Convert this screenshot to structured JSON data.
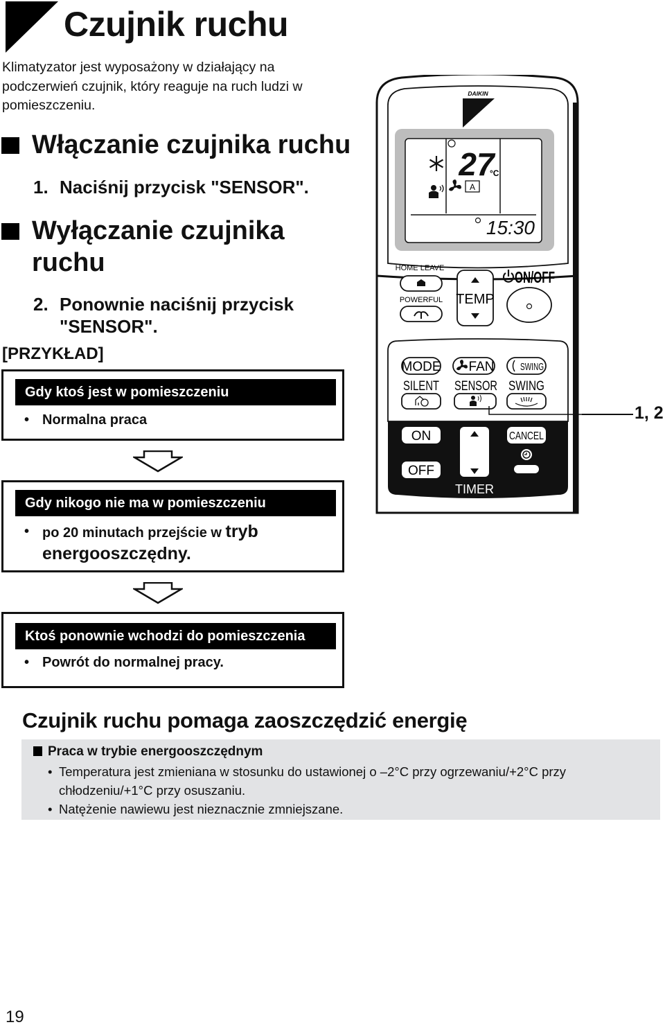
{
  "header": {
    "title": "Czujnik ruchu",
    "intro": "Klimatyzator jest wyposażony w działający na podczerwień czujnik, który reaguje na ruch ludzi w pomieszczeniu."
  },
  "sections": [
    {
      "heading_line1": "Włączanie czujnika ruchu",
      "step_num": "1.",
      "step_text": "Naciśnij przycisk \"SENSOR\"."
    },
    {
      "heading_line1": "Wyłączanie czujnika",
      "heading_line2": "ruchu",
      "step_num": "2.",
      "step_text_line1": "Ponownie naciśnij przycisk",
      "step_text_line2": "\"SENSOR\"."
    }
  ],
  "example": {
    "label": "[PRZYKŁAD]",
    "boxes": [
      {
        "title": "Gdy ktoś jest w pomieszczeniu",
        "bullet": "•",
        "item": "Normalna praca"
      },
      {
        "title": "Gdy nikogo nie ma w pomieszczeniu",
        "bullet": "•",
        "item_part1": "po 20 minutach przejście w",
        "item_part2": "tryb",
        "item_line2": "energooszczędny."
      },
      {
        "title": "Ktoś ponownie wchodzi do pomieszczenia",
        "bullet": "•",
        "item": "Powrót do normalnej pracy."
      }
    ]
  },
  "remote": {
    "brand": "DAIKIN",
    "display": {
      "temperature": "27",
      "unit": "°C",
      "clock": "15:30",
      "mode_icon": "snowflake-cool-icon",
      "sensor_icon": "person-sensor-icon",
      "fan_icon": "fan-icon",
      "fan_mode": "A"
    },
    "buttons": {
      "home_leave": "HOME LEAVE",
      "powerful": "POWERFUL",
      "temp": "TEMP",
      "on_off": "ON/OFF",
      "mode": "MODE",
      "fan": "FAN",
      "swing_top": "SWING",
      "silent": "SILENT",
      "sensor": "SENSOR",
      "swing": "SWING",
      "timer_on": "ON",
      "timer_off": "OFF",
      "cancel": "CANCEL",
      "timer": "TIMER"
    },
    "callout": "1, 2"
  },
  "energy": {
    "title": "Czujnik ruchu pomaga zaoszczędzić energię",
    "subheading": "Praca w trybie energooszczędnym",
    "items": [
      "Temperatura jest zmieniana w stosunku do ustawionej o –2°C przy ogrzewaniu/+2°C przy chłodzeniu/+1°C przy osuszaniu.",
      "Natężenie nawiewu jest nieznacznie zmniejszane."
    ],
    "bullet": "•"
  },
  "footer": {
    "page_number": "19"
  }
}
